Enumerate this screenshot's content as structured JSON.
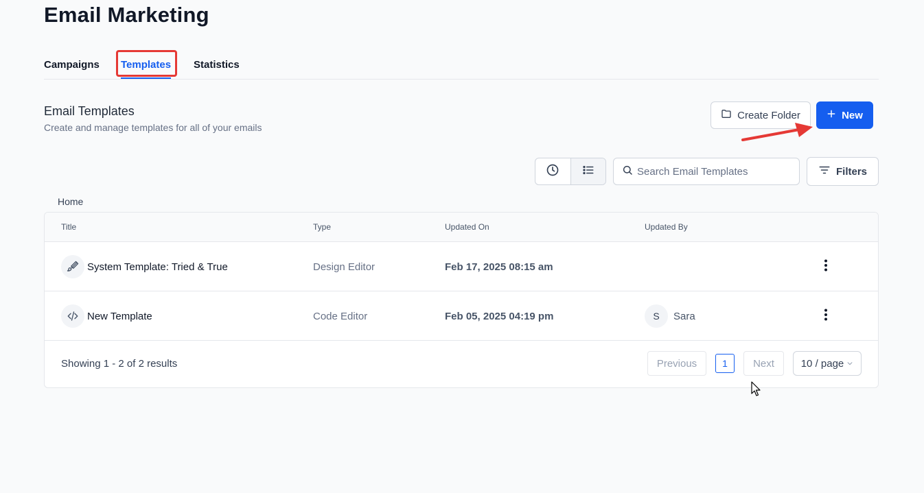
{
  "page": {
    "title": "Email Marketing"
  },
  "tabs": [
    {
      "label": "Campaigns"
    },
    {
      "label": "Templates"
    },
    {
      "label": "Statistics"
    }
  ],
  "section": {
    "title": "Email Templates",
    "subtitle": "Create and manage templates for all of your emails"
  },
  "actions": {
    "create_folder_label": "Create Folder",
    "new_label": "New"
  },
  "toolbar": {
    "search_placeholder": "Search Email Templates",
    "filters_label": "Filters"
  },
  "breadcrumb": "Home",
  "table": {
    "columns": [
      "Title",
      "Type",
      "Updated On",
      "Updated By"
    ],
    "rows": [
      {
        "icon": "paintbrush-icon",
        "title": "System Template: Tried & True",
        "type": "Design Editor",
        "updated_on": "Feb 17, 2025 08:15 am",
        "updated_by_initial": "",
        "updated_by": ""
      },
      {
        "icon": "code-icon",
        "title": "New Template",
        "type": "Code Editor",
        "updated_on": "Feb 05, 2025 04:19 pm",
        "updated_by_initial": "S",
        "updated_by": "Sara"
      }
    ]
  },
  "pagination": {
    "showing": "Showing 1 - 2 of 2 results",
    "previous": "Previous",
    "current_page": "1",
    "next": "Next",
    "page_size": "10 / page"
  },
  "colors": {
    "accent": "#155eef",
    "annotation": "#e53935"
  }
}
